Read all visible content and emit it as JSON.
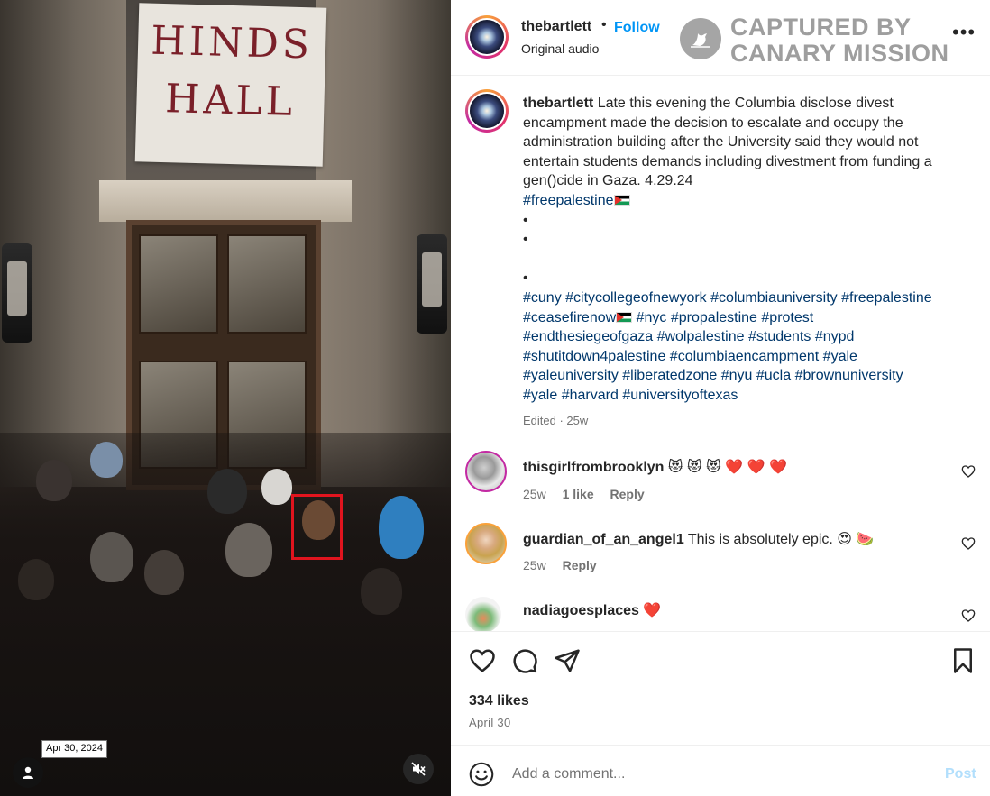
{
  "post": {
    "username": "thebartlett",
    "follow_label": "Follow",
    "audio_label": "Original audio",
    "watermark": [
      "CAPTURED BY",
      "CANARY MISSION"
    ],
    "more_label": "•••",
    "banner_text": [
      "HINDS",
      "HALL"
    ]
  },
  "caption": {
    "username": "thebartlett",
    "text": "Late this evening the Columbia disclose divest encampment made the decision to escalate and occupy the administration building after the University said they would not entertain students demands including divestment from funding a gen()cide in Gaza. 4.29.24",
    "hashtag_primary": "#freepalestine",
    "bullet": "•",
    "hashtags": [
      "#cuny",
      "#citycollegeofnewyork",
      "#columbiauniversity",
      "#freepalestine",
      "#ceasefirenow",
      "#nyc",
      "#propalestine",
      "#protest",
      "#endthesiegeofgaza",
      "#wolpalestine",
      "#students",
      "#nypd",
      "#shutitdown4palestine",
      "#columbiaencampment",
      "#yale",
      "#yaleuniversity",
      "#liberatedzone",
      "#nyu",
      "#ucla",
      "#brownuniversity",
      "#yale",
      "#harvard",
      "#universityoftexas"
    ],
    "edited": "Edited · 25w"
  },
  "comments": [
    {
      "username": "thisgirlfrombrooklyn",
      "text": "",
      "emojis": "😻 😻 😻 ❤️ ❤️ ❤️",
      "age": "25w",
      "likes": "1 like",
      "reply": "Reply"
    },
    {
      "username": "guardian_of_an_angel1",
      "text": "This is absolutely epic.",
      "emojis": "😍 🍉",
      "age": "25w",
      "likes": "",
      "reply": "Reply"
    },
    {
      "username": "nadiagoesplaces",
      "text": "",
      "emojis": "❤️",
      "age": "",
      "likes": "",
      "reply": ""
    }
  ],
  "stats": {
    "likes": "334 likes",
    "date": "April 30",
    "date_tooltip": "Apr 30, 2024"
  },
  "composer": {
    "placeholder": "Add a comment...",
    "post_label": "Post"
  },
  "colors": {
    "link_blue": "#0095f6",
    "hashtag": "#00376b",
    "highlight_box": "#e0141e"
  }
}
